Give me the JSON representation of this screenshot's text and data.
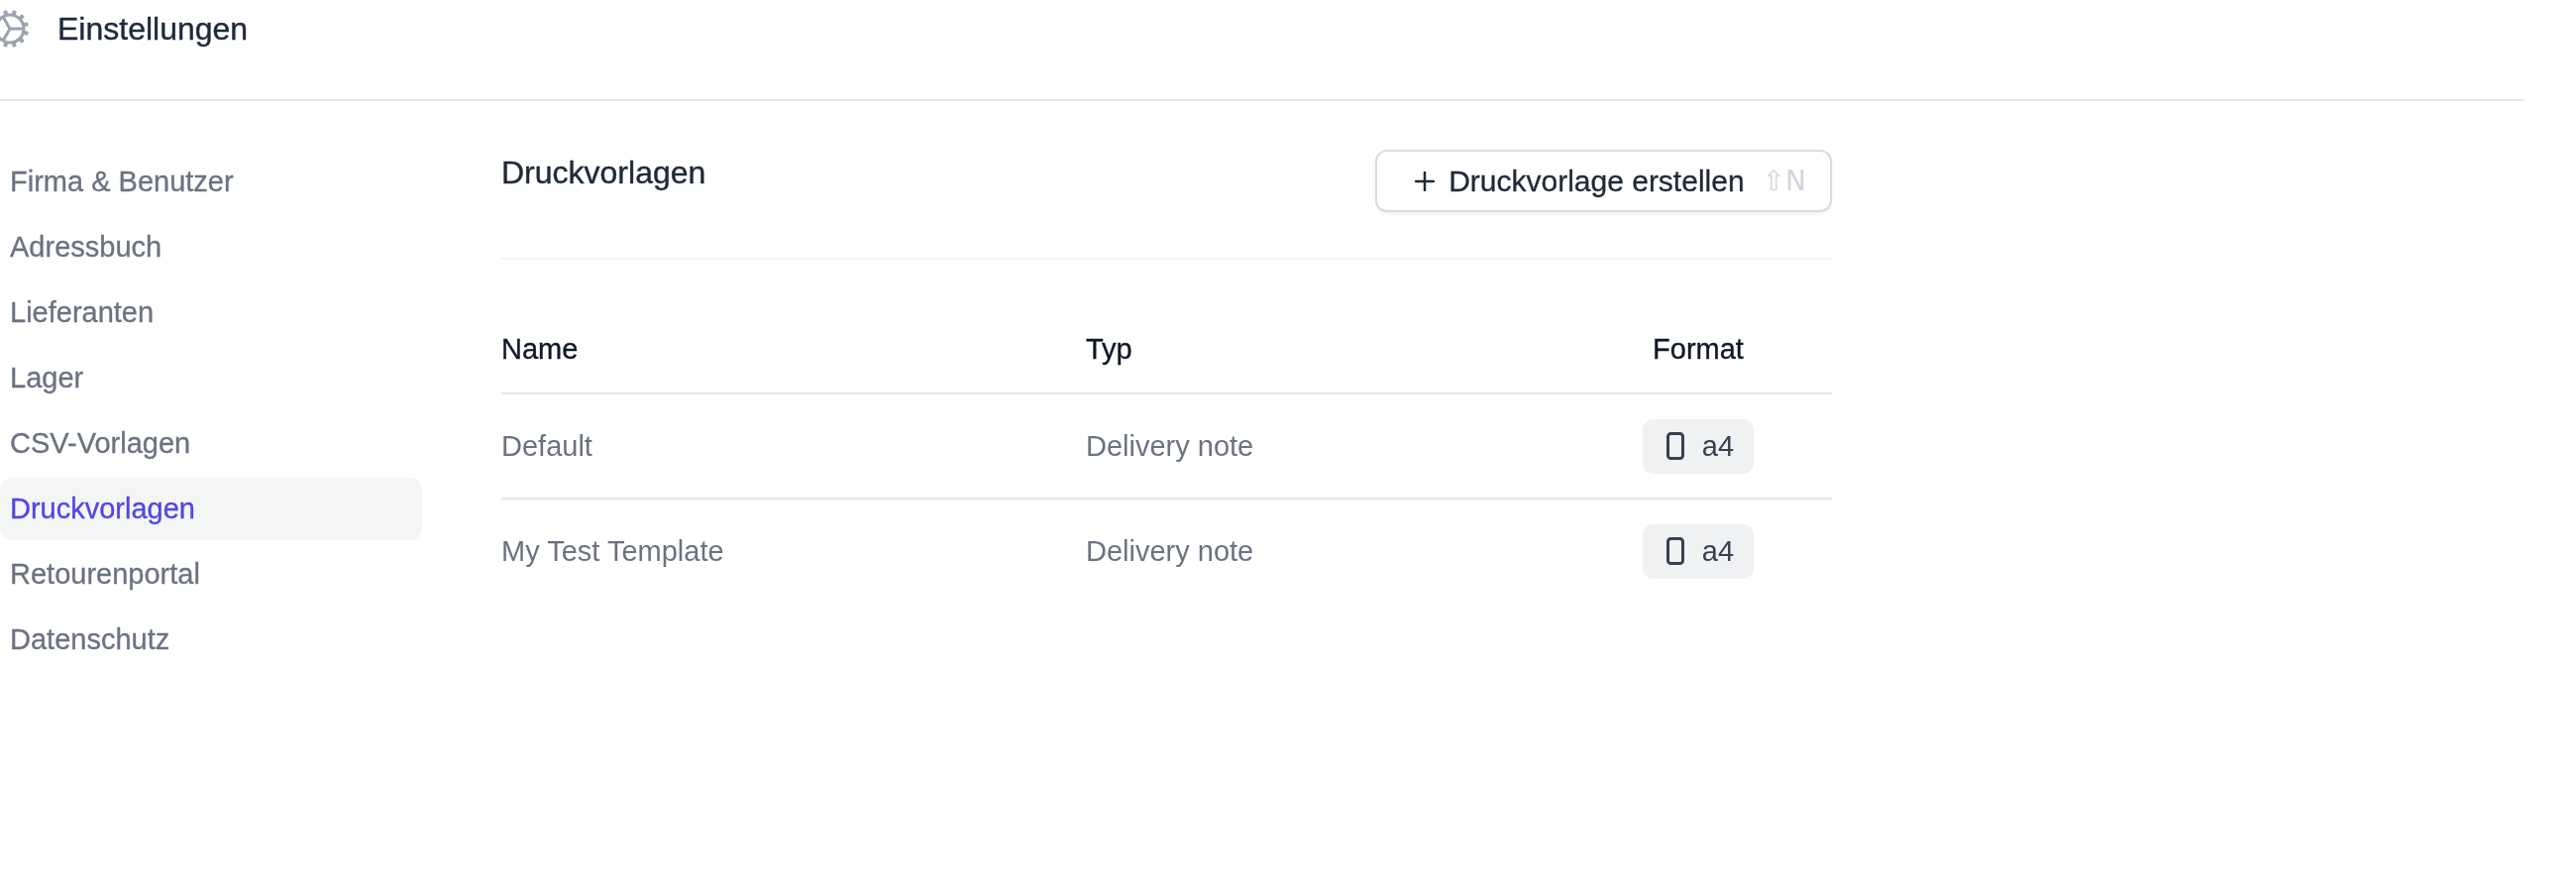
{
  "header": {
    "title": "Einstellungen"
  },
  "sidebar": {
    "items": [
      {
        "label": "Firma & Benutzer",
        "selected": false
      },
      {
        "label": "Adressbuch",
        "selected": false
      },
      {
        "label": "Lieferanten",
        "selected": false
      },
      {
        "label": "Lager",
        "selected": false
      },
      {
        "label": "CSV-Vorlagen",
        "selected": false
      },
      {
        "label": "Druckvorlagen",
        "selected": true
      },
      {
        "label": "Retourenportal",
        "selected": false
      },
      {
        "label": "Datenschutz",
        "selected": false
      }
    ]
  },
  "page": {
    "title": "Druckvorlagen",
    "create_button": {
      "label": "Druckvorlage erstellen",
      "shortcut": "⇧N"
    }
  },
  "table": {
    "columns": [
      "Name",
      "Typ",
      "Format"
    ],
    "rows": [
      {
        "name": "Default",
        "type": "Delivery note",
        "format": "a4"
      },
      {
        "name": "My Test Template",
        "type": "Delivery note",
        "format": "a4"
      }
    ]
  }
}
